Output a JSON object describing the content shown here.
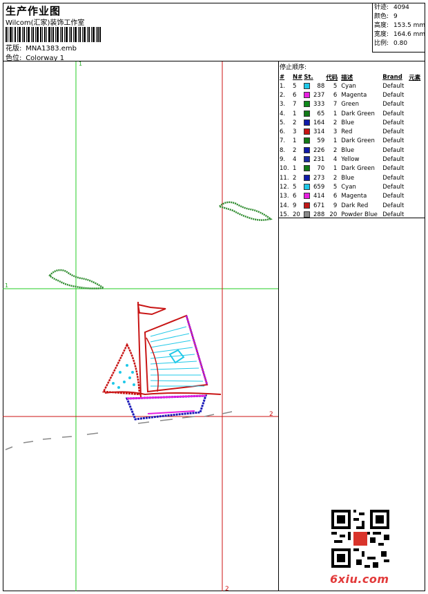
{
  "header": {
    "title": "生产作业图",
    "company": "Wilcom(汇家)装饰工作室",
    "design_label": "花版:",
    "design_value": "MNA1383.emb",
    "colorway_label": "色位:",
    "colorway_value": "Colorway 1"
  },
  "stats": {
    "stitches_label": "针迹:",
    "stitches_value": "4094",
    "colors_label": "颜色:",
    "colors_value": "9",
    "height_label": "高度:",
    "height_value": "153.5 mm",
    "width_label": "宽度:",
    "width_value": "164.6 mm",
    "scale_label": "比例:",
    "scale_value": "0.80"
  },
  "stop_sequence": {
    "title": "停止顺序:",
    "columns": [
      "#",
      "N#",
      "St.",
      "代码",
      "描述",
      "Brand",
      "元素"
    ],
    "rows": [
      {
        "idx": "1.",
        "n": "5",
        "color": "#1fc8e8",
        "st": "88",
        "code": "5",
        "desc": "Cyan",
        "brand": "Default"
      },
      {
        "idx": "2.",
        "n": "6",
        "color": "#e81fe0",
        "st": "237",
        "code": "6",
        "desc": "Magenta",
        "brand": "Default"
      },
      {
        "idx": "3.",
        "n": "7",
        "color": "#0f8a1a",
        "st": "333",
        "code": "7",
        "desc": "Green",
        "brand": "Default"
      },
      {
        "idx": "4.",
        "n": "1",
        "color": "#127a16",
        "st": "65",
        "code": "1",
        "desc": "Dark Green",
        "brand": "Default"
      },
      {
        "idx": "5.",
        "n": "2",
        "color": "#101aa8",
        "st": "164",
        "code": "2",
        "desc": "Blue",
        "brand": "Default"
      },
      {
        "idx": "6.",
        "n": "3",
        "color": "#c81414",
        "st": "314",
        "code": "3",
        "desc": "Red",
        "brand": "Default"
      },
      {
        "idx": "7.",
        "n": "1",
        "color": "#127a16",
        "st": "59",
        "code": "1",
        "desc": "Dark Green",
        "brand": "Default"
      },
      {
        "idx": "8.",
        "n": "2",
        "color": "#101aa8",
        "st": "226",
        "code": "2",
        "desc": "Blue",
        "brand": "Default"
      },
      {
        "idx": "9.",
        "n": "4",
        "color": "#1a2aa0",
        "st": "231",
        "code": "4",
        "desc": "Yellow",
        "brand": "Default"
      },
      {
        "idx": "10.",
        "n": "1",
        "color": "#127a16",
        "st": "70",
        "code": "1",
        "desc": "Dark Green",
        "brand": "Default"
      },
      {
        "idx": "11.",
        "n": "2",
        "color": "#101aa8",
        "st": "273",
        "code": "2",
        "desc": "Blue",
        "brand": "Default"
      },
      {
        "idx": "12.",
        "n": "5",
        "color": "#1fc8e8",
        "st": "659",
        "code": "5",
        "desc": "Cyan",
        "brand": "Default"
      },
      {
        "idx": "13.",
        "n": "6",
        "color": "#e81fe0",
        "st": "414",
        "code": "6",
        "desc": "Magenta",
        "brand": "Default"
      },
      {
        "idx": "14.",
        "n": "9",
        "color": "#c01818",
        "st": "671",
        "code": "9",
        "desc": "Dark Red",
        "brand": "Default"
      },
      {
        "idx": "15.",
        "n": "20",
        "color": "#8a8a8a",
        "st": "288",
        "code": "20",
        "desc": "Powder Blue",
        "brand": "Default"
      }
    ]
  },
  "canvas": {
    "guide_labels": {
      "green_top": "1",
      "green_left": "1",
      "red_right": "2",
      "red_bottom": "2"
    },
    "colors": {
      "green_guide": "#22cc22",
      "red_guide": "#cc1010"
    }
  },
  "watermark": {
    "site": "6xiu.com"
  }
}
